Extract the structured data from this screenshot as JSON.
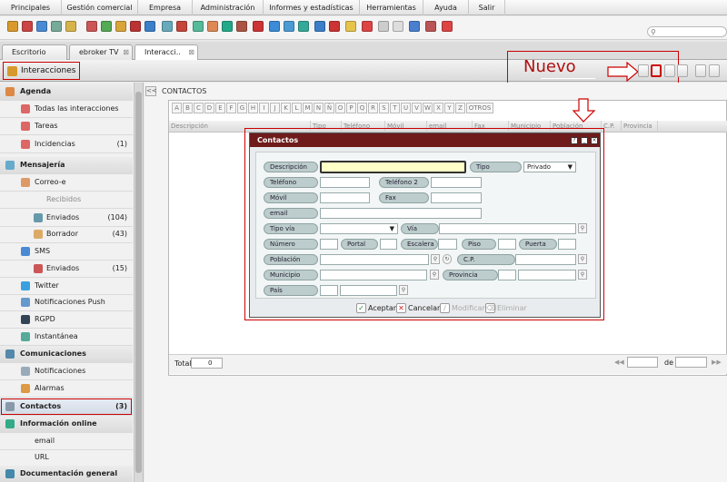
{
  "menu": [
    "Principales",
    "Gestión comercial",
    "Empresa",
    "Administración",
    "Informes y estadísticas",
    "Herramientas",
    "Ayuda",
    "Salir"
  ],
  "tabs": [
    {
      "label": "Escritorio",
      "closable": false
    },
    {
      "label": "ebroker TV",
      "closable": true
    },
    {
      "label": "Interacci..",
      "closable": true,
      "active": true
    }
  ],
  "module_title": "Interacciones",
  "annotation": {
    "nuevo": "Nuevo"
  },
  "sidebar": {
    "agenda": {
      "label": "Agenda",
      "items": [
        {
          "label": "Todas las interacciones"
        },
        {
          "label": "Tareas"
        },
        {
          "label": "Incidencias",
          "count": "(1)"
        }
      ]
    },
    "mensajeria": {
      "label": "Mensajería",
      "items": [
        {
          "label": "Correo-e"
        },
        {
          "label": "Recibidos"
        },
        {
          "label": "Enviados",
          "count": "(104)"
        },
        {
          "label": "Borrador",
          "count": "(43)"
        },
        {
          "label": "SMS"
        },
        {
          "label": "Enviados",
          "count": "(15)"
        },
        {
          "label": "Twitter"
        },
        {
          "label": "Notificaciones Push"
        },
        {
          "label": "RGPD"
        },
        {
          "label": "Instantánea"
        }
      ]
    },
    "comunicaciones": {
      "label": "Comunicaciones",
      "items": [
        {
          "label": "Notificaciones"
        },
        {
          "label": "Alarmas"
        }
      ]
    },
    "contactos": {
      "label": "Contactos",
      "count": "(3)"
    },
    "informacion": {
      "label": "Información online",
      "items": [
        {
          "label": "email"
        },
        {
          "label": "URL"
        }
      ]
    },
    "documentacion": {
      "label": "Documentación general"
    }
  },
  "contacts_panel": {
    "collapse_label": "<<",
    "title": "CONTACTOS",
    "letters": [
      "A",
      "B",
      "C",
      "D",
      "E",
      "F",
      "G",
      "H",
      "I",
      "J",
      "K",
      "L",
      "M",
      "N",
      "Ñ",
      "O",
      "P",
      "Q",
      "R",
      "S",
      "T",
      "U",
      "V",
      "W",
      "X",
      "Y",
      "Z",
      "OTROS"
    ],
    "columns": [
      "Descripción",
      "Tipo",
      "Teléfono",
      "Móvil",
      "email",
      "Fax",
      "Municipio",
      "Población",
      "C.P.",
      "Provincia"
    ],
    "total_label": "Total",
    "total_value": "0",
    "page_of": "de",
    "nav": {
      "first": "◀◀",
      "prev": "◀",
      "next": "▶",
      "last": "▶▶"
    }
  },
  "dialog": {
    "title": "Contactos",
    "controls": {
      "help": "?",
      "minimize": "_",
      "close": "×"
    },
    "fields": {
      "descripcion": "Descripción",
      "tipo": "Tipo",
      "tipo_value": "Privado",
      "telefono": "Teléfono",
      "telefono2": "Teléfono 2",
      "movil": "Móvil",
      "fax": "Fax",
      "email": "email",
      "tipo_via": "Tipo vía",
      "via": "Vía",
      "numero": "Número",
      "portal": "Portal",
      "escalera": "Escalera",
      "piso": "Piso",
      "puerta": "Puerta",
      "poblacion": "Población",
      "cp": "C.P.",
      "municipio": "Municipio",
      "provincia": "Provincia",
      "pais": "País"
    },
    "buttons": {
      "accept": "Aceptar",
      "cancel": "Cancelar",
      "modify": "Modificar",
      "delete": "Eliminar"
    }
  },
  "colors": {
    "dialog_title": "#6f1b1b",
    "annotation": "#c00000",
    "field_label": "#bdcccc"
  }
}
